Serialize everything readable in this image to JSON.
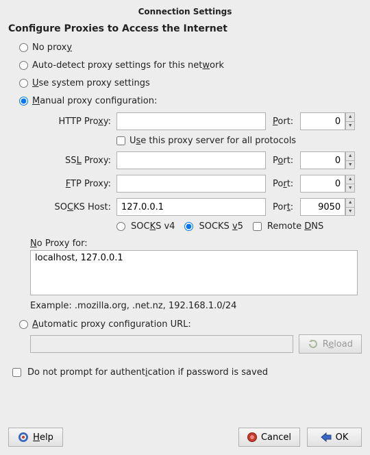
{
  "title": "Connection Settings",
  "heading": "Configure Proxies to Access the Internet",
  "radios": {
    "no_proxy": "No proxy",
    "auto_detect": "Auto-detect proxy settings for this network",
    "system": "Use system proxy settings",
    "manual": "Manual proxy configuration:",
    "auto_url": "Automatic proxy configuration URL:",
    "selected": "manual"
  },
  "fields": {
    "http": {
      "label": "HTTP Proxy:",
      "host": "",
      "port": "0",
      "port_label": "Port:"
    },
    "ssl": {
      "label": "SSL Proxy:",
      "host": "",
      "port": "0",
      "port_label": "Port:"
    },
    "ftp": {
      "label": "FTP Proxy:",
      "host": "",
      "port": "0",
      "port_label": "Port:"
    },
    "socks": {
      "label": "SOCKS Host:",
      "host": "127.0.0.1",
      "port": "9050",
      "port_label": "Port:"
    }
  },
  "use_all": {
    "label": "Use this proxy server for all protocols",
    "checked": false
  },
  "socks_version": {
    "v4": "SOCKS v4",
    "v5": "SOCKS v5",
    "selected": "v5"
  },
  "remote_dns": {
    "label": "Remote DNS",
    "checked": false
  },
  "noproxy": {
    "label": "No Proxy for:",
    "value": "localhost, 127.0.0.1",
    "example": "Example: .mozilla.org, .net.nz, 192.168.1.0/24"
  },
  "auto_url_value": "",
  "reload_label": "Reload",
  "do_not_prompt": {
    "label": "Do not prompt for authentication if password is saved",
    "checked": false
  },
  "buttons": {
    "help": "Help",
    "cancel": "Cancel",
    "ok": "OK"
  }
}
